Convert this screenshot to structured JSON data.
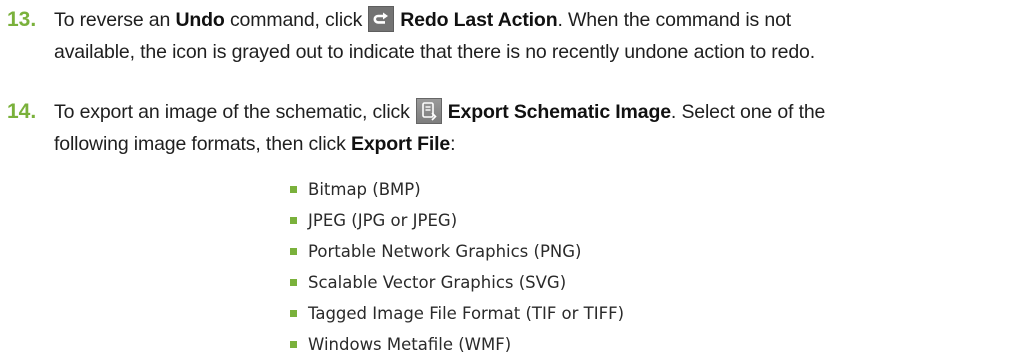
{
  "step13": {
    "number": "13.",
    "text_before": "To reverse an ",
    "undo_label": "Undo",
    "text_mid": " command, click",
    "redo_icon": "redo-icon",
    "redo_label": "Redo Last Action",
    "text_after": ". When the command is not",
    "line2": "available, the icon is grayed out to indicate that there is no recently undone action to redo."
  },
  "step14": {
    "number": "14.",
    "text_before": "To export an image of the schematic, click",
    "export_icon": "export-image-icon",
    "export_label": "Export Schematic Image",
    "text_after": ". Select one of the",
    "line2_before": "following image formats, then click ",
    "export_file_label": "Export File",
    "line2_after": ":"
  },
  "formats": [
    "Bitmap (BMP)",
    "JPEG (JPG or JPEG)",
    "Portable Network Graphics (PNG)",
    "Scalable Vector Graphics (SVG)",
    "Tagged Image File Format (TIF or TIFF)",
    "Windows Metafile (WMF)"
  ],
  "colors": {
    "step_number": "#7ab13b",
    "bullet": "#7ab13b",
    "icon_bg": "#737373"
  }
}
